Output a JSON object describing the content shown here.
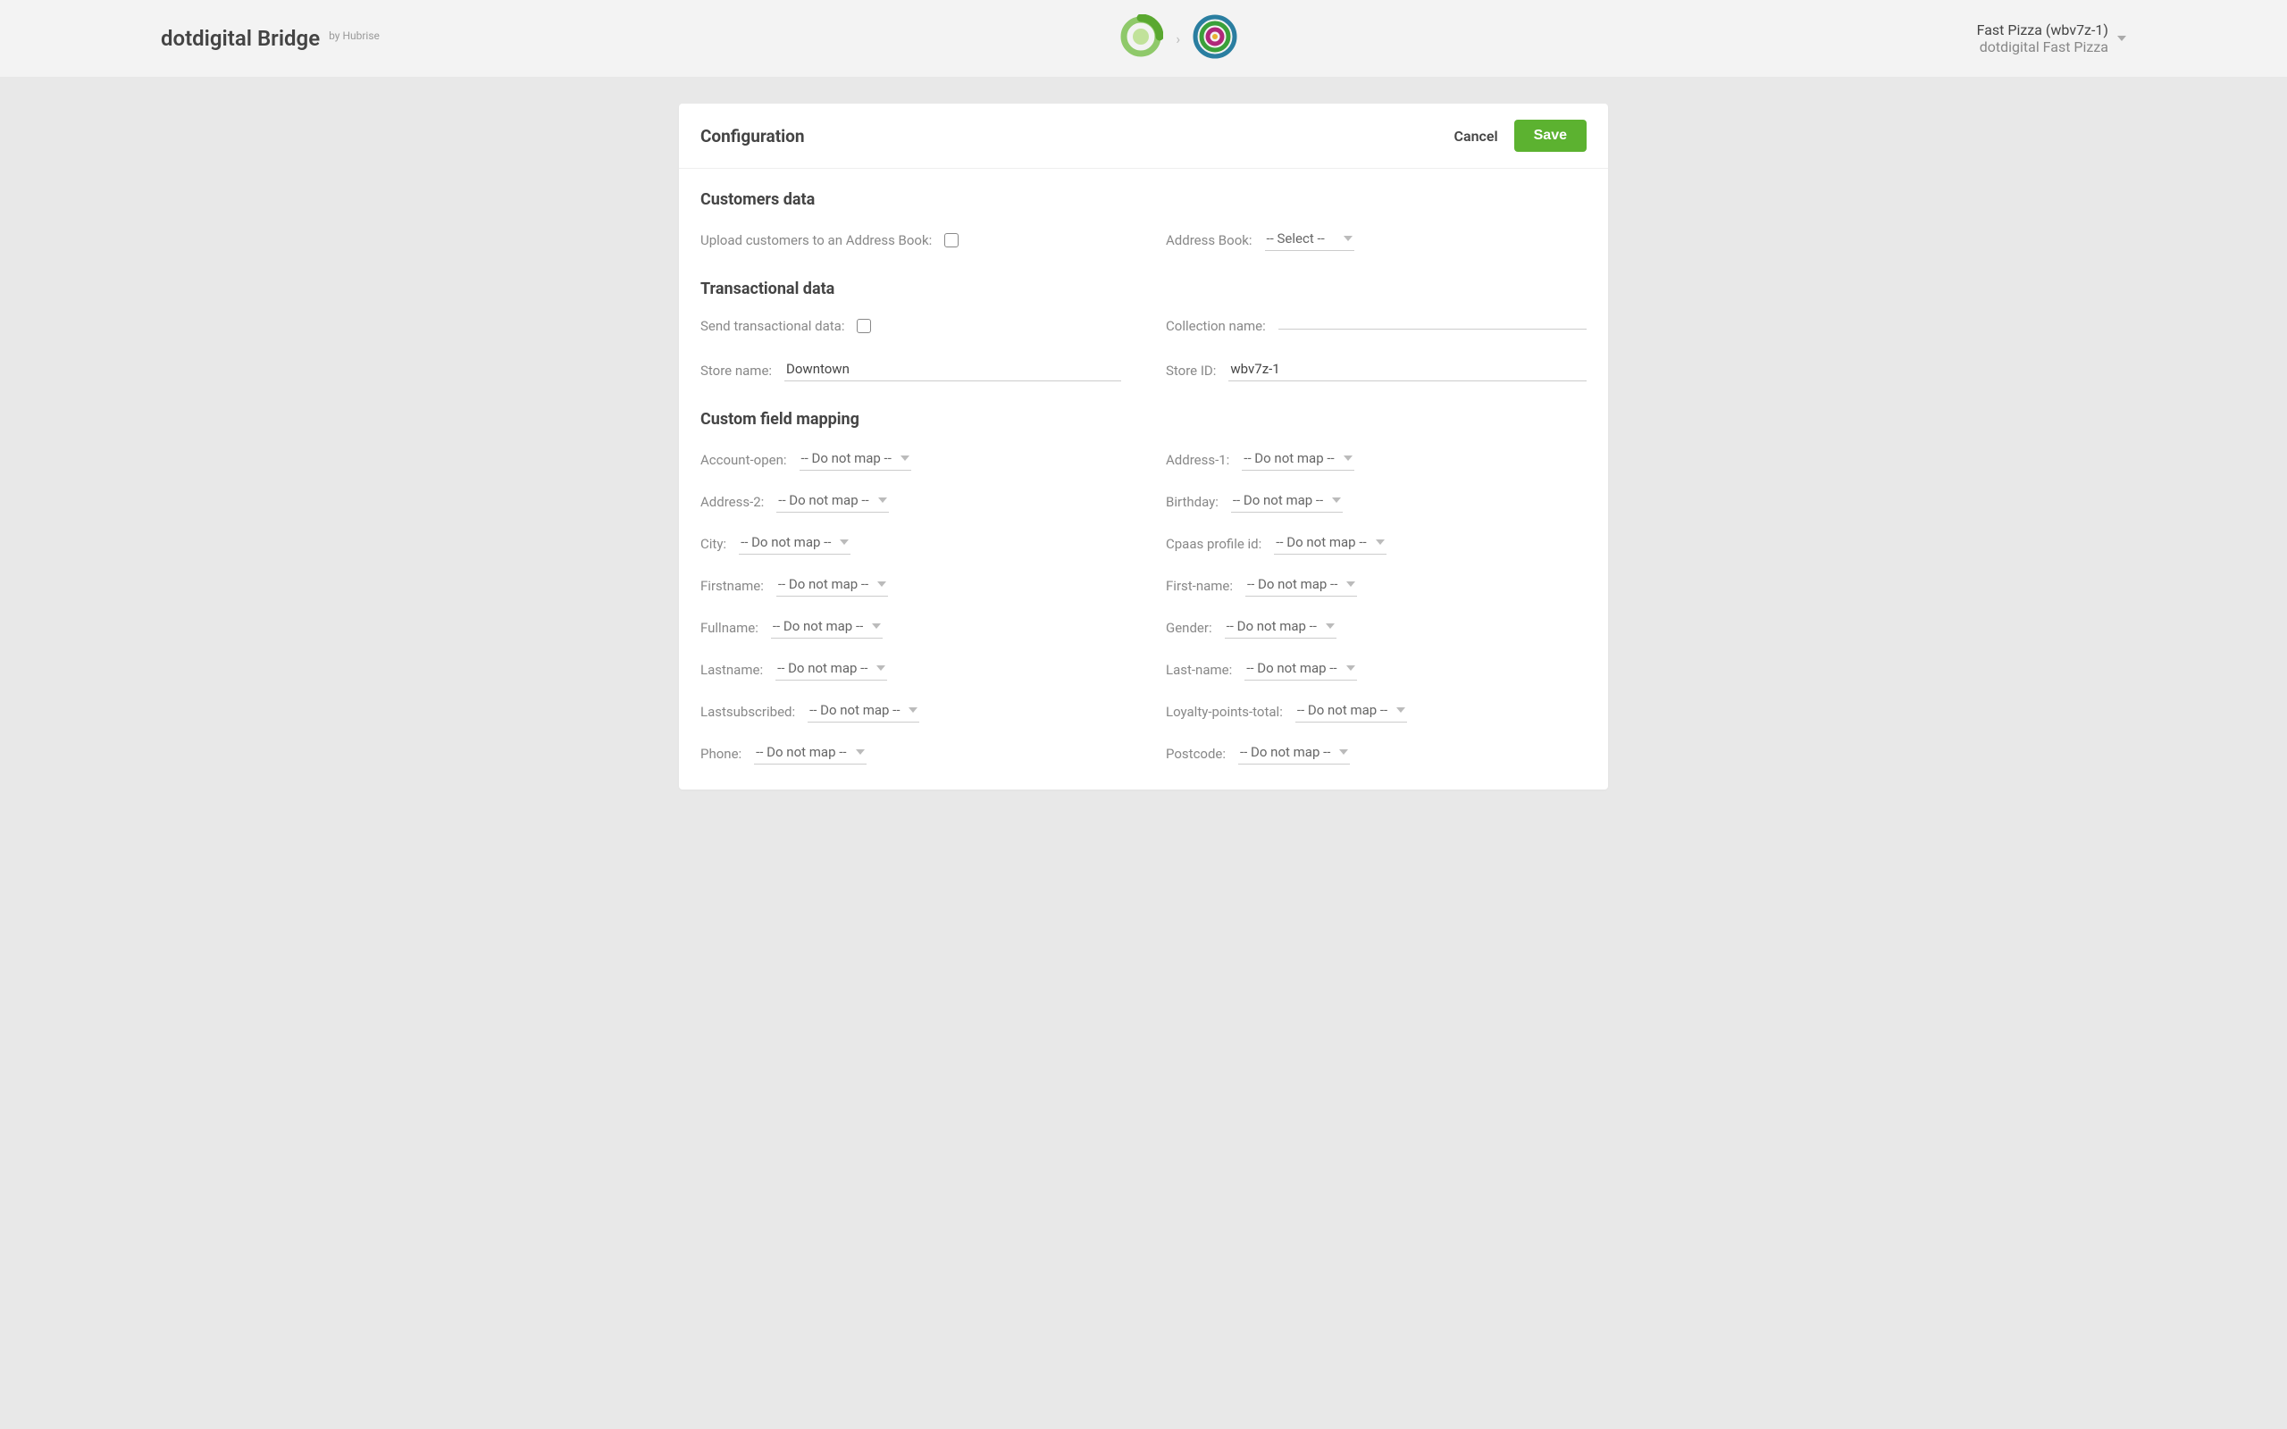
{
  "header": {
    "app_title": "dotdigital Bridge",
    "byline": "by Hubrise",
    "org_name": "Fast Pizza (wbv7z-1)",
    "account_name": "dotdigital Fast Pizza"
  },
  "card": {
    "title": "Configuration",
    "cancel": "Cancel",
    "save": "Save"
  },
  "sections": {
    "customers": {
      "title": "Customers data",
      "upload_label": "Upload customers to an Address Book:",
      "address_book_label": "Address Book:",
      "address_book_value": "-- Select --"
    },
    "transactional": {
      "title": "Transactional data",
      "send_label": "Send transactional data:",
      "collection_label": "Collection name:",
      "collection_value": "",
      "store_name_label": "Store name:",
      "store_name_value": "Downtown",
      "store_id_label": "Store ID:",
      "store_id_value": "wbv7z-1"
    },
    "mapping": {
      "title": "Custom field mapping",
      "default_value": "-- Do not map --",
      "fields_left": [
        {
          "label": "Account-open:"
        },
        {
          "label": "Address-2:"
        },
        {
          "label": "City:"
        },
        {
          "label": "Firstname:"
        },
        {
          "label": "Fullname:"
        },
        {
          "label": "Lastname:"
        },
        {
          "label": "Lastsubscribed:"
        },
        {
          "label": "Phone:"
        }
      ],
      "fields_right": [
        {
          "label": "Address-1:"
        },
        {
          "label": "Birthday:"
        },
        {
          "label": "Cpaas profile id:"
        },
        {
          "label": "First-name:"
        },
        {
          "label": "Gender:"
        },
        {
          "label": "Last-name:"
        },
        {
          "label": "Loyalty-points-total:"
        },
        {
          "label": "Postcode:"
        }
      ]
    }
  }
}
